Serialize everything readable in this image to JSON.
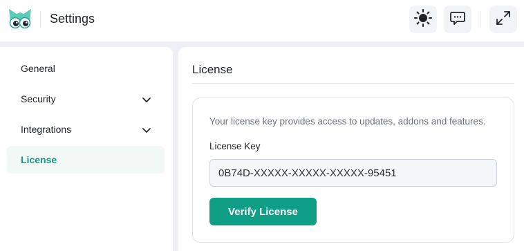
{
  "header": {
    "title": "Settings",
    "logo_icon": "owl-logo-icon",
    "theme_toggle_icon": "sun-icon",
    "feedback_icon": "chat-bubble-icon",
    "expand_icon": "expand-arrows-icon"
  },
  "sidebar": {
    "items": [
      {
        "label": "General",
        "has_chevron": false,
        "active": false
      },
      {
        "label": "Security",
        "has_chevron": true,
        "active": false
      },
      {
        "label": "Integrations",
        "has_chevron": true,
        "active": false
      },
      {
        "label": "License",
        "has_chevron": false,
        "active": true
      }
    ]
  },
  "main": {
    "title": "License",
    "card": {
      "description": "Your license key provides access to updates, addons and features.",
      "field_label": "License Key",
      "license_value": "0B74D-XXXXX-XXXXX-XXXXX-95451",
      "button_label": "Verify License"
    }
  },
  "colors": {
    "accent": "#0f9e86",
    "active_text": "#179a85",
    "active_bg": "#f2f8f6",
    "page_bg": "#eef0f5"
  }
}
